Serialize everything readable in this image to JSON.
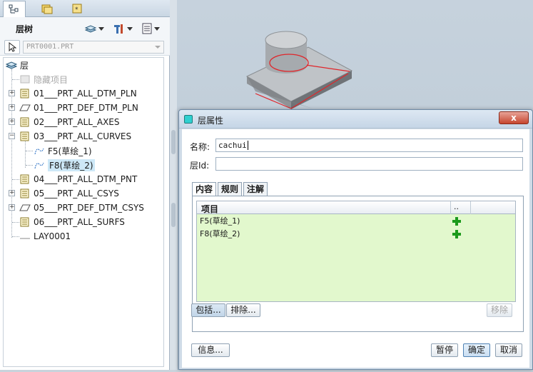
{
  "left_panel": {
    "tree_title": "层树",
    "model_selector": "PRT0001.PRT",
    "root_label": "层",
    "tree_items": [
      {
        "label": "隐藏项目",
        "dim": true
      },
      {
        "label": "01___PRT_ALL_DTM_PLN"
      },
      {
        "label": "01___PRT_DEF_DTM_PLN"
      },
      {
        "label": "02___PRT_ALL_AXES"
      },
      {
        "label": "03___PRT_ALL_CURVES"
      },
      {
        "label": "F5(草绘_1)"
      },
      {
        "label": "F8(草绘_2)"
      },
      {
        "label": "04___PRT_ALL_DTM_PNT"
      },
      {
        "label": "05___PRT_ALL_CSYS"
      },
      {
        "label": "05___PRT_DEF_DTM_CSYS"
      },
      {
        "label": "06___PRT_ALL_SURFS"
      },
      {
        "label": "LAY0001"
      }
    ]
  },
  "dialog": {
    "title": "层属性",
    "close_label": "x",
    "name_label": "名称:",
    "name_value": "cachui",
    "layer_id_label": "层Id:",
    "layer_id_value": "",
    "tabs": [
      "内容",
      "规则",
      "注解"
    ],
    "grid": {
      "header_item": "项目",
      "header_status": "..",
      "rows": [
        "F5(草绘_1)",
        "F8(草绘_2)"
      ]
    },
    "include_button": "包括...",
    "exclude_button": "排除...",
    "remove_button": "移除",
    "info_button": "信息...",
    "pause_button": "暂停",
    "ok_button": "确定",
    "cancel_button": "取消"
  }
}
